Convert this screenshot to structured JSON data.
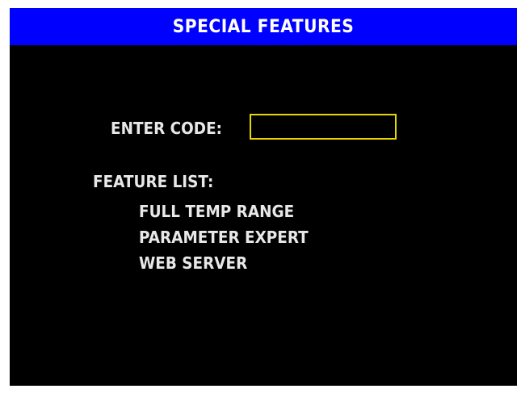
{
  "screen": {
    "title": "SPECIAL FEATURES",
    "title_bar_color": "#0000fe",
    "background_color": "#000000",
    "input_border_color": "#e8d800"
  },
  "code_entry": {
    "label": "ENTER CODE:",
    "value": ""
  },
  "features": {
    "heading": "FEATURE LIST:",
    "items": [
      "FULL TEMP RANGE",
      "PARAMETER EXPERT",
      "WEB SERVER"
    ]
  }
}
